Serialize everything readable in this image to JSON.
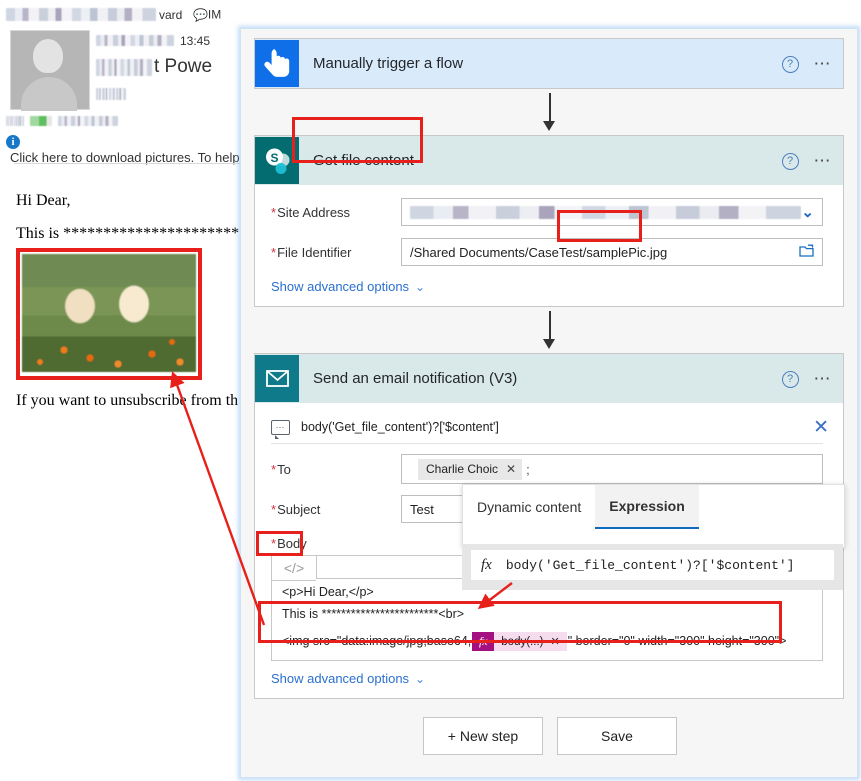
{
  "email_pane": {
    "toolbar": {
      "forward_label": "vard",
      "im_label": "IM",
      "im_icon": "chat-icon"
    },
    "time": "13:45",
    "subject_visible_text": "t Powe",
    "info_bar": {
      "icon": "info-icon",
      "text": "Click here to download pictures. To help"
    },
    "greeting": "Hi Dear,",
    "body_line_prefix": "This is ",
    "body_line_stars": "************************",
    "image_alt": "two-golden-retriever-puppies-photo",
    "unsubscribe_text": "If you want to unsubscribe from th"
  },
  "flow": {
    "trigger": {
      "icon": "touch-hand-icon",
      "title": "Manually trigger a flow",
      "help_icon": "question-mark-icon",
      "more_icon": "ellipsis-icon"
    },
    "get_file_content": {
      "icon": "sharepoint-icon",
      "title": "Get file content",
      "help_icon": "question-mark-icon",
      "more_icon": "ellipsis-icon",
      "fields": [
        {
          "label": "Site Address",
          "required": "*",
          "value": "",
          "value_redacted": true,
          "control": "dropdown",
          "control_icon": "chevron-down-icon"
        },
        {
          "label": "File Identifier",
          "required": "*",
          "value": "/Shared Documents/CaseTest/samplePic.jpg",
          "value_redacted": false,
          "control": "file-picker",
          "control_icon": "folder-icon"
        }
      ],
      "advanced_link": "Show advanced options",
      "advanced_chevron": "chevron-down-icon"
    },
    "send_email": {
      "icon": "envelope-icon",
      "title": "Send an email notification (V3)",
      "help_icon": "question-mark-icon",
      "more_icon": "ellipsis-icon",
      "tooltip_bar": {
        "icon": "tooltip-icon",
        "text": "body('Get_file_content')?['$content']",
        "close_icon": "close-icon"
      },
      "to": {
        "label": "To",
        "required": "*",
        "chip_label": "Charlie Choic",
        "chip_remove_icon": "close-icon",
        "separator": ";"
      },
      "subject": {
        "label": "Subject",
        "required": "*",
        "value": "Test"
      },
      "body": {
        "label": "Body",
        "required": "*",
        "code_button_label": "</>",
        "lines": [
          {
            "text": "<p>Hi Dear,</p>"
          },
          {
            "text": "This is ************************<br>"
          }
        ],
        "img_line": {
          "prefix": "<img src=\"data:image/jpg;base64,",
          "token_fx": "fx",
          "token_label": "body(...)",
          "token_remove_icon": "close-icon",
          "suffix": "\" border=\"0\" width=\"300\" height=\"300\">"
        }
      },
      "advanced_link": "Show advanced options",
      "advanced_chevron": "chevron-down-icon"
    },
    "expression_flyout": {
      "tab_dynamic": "Dynamic content",
      "tab_expression": "Expression",
      "fx_label": "fx",
      "expression_value": "body('Get_file_content')?['$content']"
    },
    "buttons": {
      "new_step": "+ New step",
      "save": "Save"
    }
  },
  "colors": {
    "annotation_red": "#e8201b",
    "trigger_header": "#d9ebfb",
    "action_header": "#d9e8e8",
    "trigger_icon_bg": "#0e6fe8",
    "sharepoint_icon_bg": "#036c70",
    "mail_icon_bg": "#0f7a8a",
    "link_blue": "#2a6fd0",
    "token_magenta": "#a4107f",
    "token_pink": "#f5dcef"
  }
}
